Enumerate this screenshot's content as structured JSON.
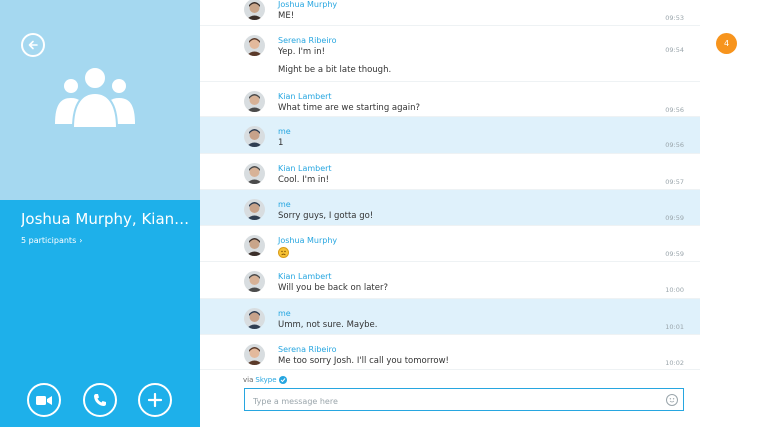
{
  "sidebar": {
    "back_icon": "arrow-left-icon",
    "group_icon": "group-people-icon",
    "title": "Joshua Murphy, Kian Lambert, Serena Ribeiro",
    "participants_label": "5 participants",
    "participants_chevron": "›",
    "actions": [
      {
        "name": "video-call-button",
        "icon": "video-camera-icon"
      },
      {
        "name": "voice-call-button",
        "icon": "phone-icon"
      },
      {
        "name": "add-button",
        "icon": "plus-icon"
      }
    ]
  },
  "unread_badge": "4",
  "messages": [
    {
      "sender": "Joshua Murphy",
      "lines": [
        "ME!"
      ],
      "time": "09:53",
      "highlight": false
    },
    {
      "sender": "Serena Ribeiro",
      "lines": [
        "Yep. I'm in!",
        "Might be a bit late though."
      ],
      "time": "09:54",
      "highlight": false
    },
    {
      "sender": "Kian Lambert",
      "lines": [
        "What time are we starting again?"
      ],
      "time": "09:56",
      "highlight": false
    },
    {
      "sender": "me",
      "lines": [
        "1"
      ],
      "time": "09:56",
      "highlight": true
    },
    {
      "sender": "Kian Lambert",
      "lines": [
        "Cool. I'm in!"
      ],
      "time": "09:57",
      "highlight": false
    },
    {
      "sender": "me",
      "lines": [
        "Sorry guys, I gotta go!"
      ],
      "time": "09:59",
      "highlight": true
    },
    {
      "sender": "Joshua Murphy",
      "lines": [],
      "emoji": "sad-face-emoji",
      "time": "09:59",
      "highlight": false
    },
    {
      "sender": "Kian Lambert",
      "lines": [
        "Will you be back on later?"
      ],
      "time": "10:00",
      "highlight": false
    },
    {
      "sender": "me",
      "lines": [
        "Umm, not sure. Maybe."
      ],
      "time": "10:01",
      "highlight": true
    },
    {
      "sender": "Serena Ribeiro",
      "lines": [
        "Me too sorry Josh. I'll call you tomorrow!"
      ],
      "time": "10:02",
      "highlight": false
    }
  ],
  "composer": {
    "via_label": "via",
    "via_service": "Skype",
    "placeholder": "Type a message here",
    "emoticon_icon": "smiley-icon"
  },
  "colors": {
    "accent": "#1eb0ea",
    "sidebar_top": "#a5d8f0",
    "highlight_row": "#dff1fb",
    "sender_name": "#27a6e0",
    "badge": "#f7941d"
  }
}
